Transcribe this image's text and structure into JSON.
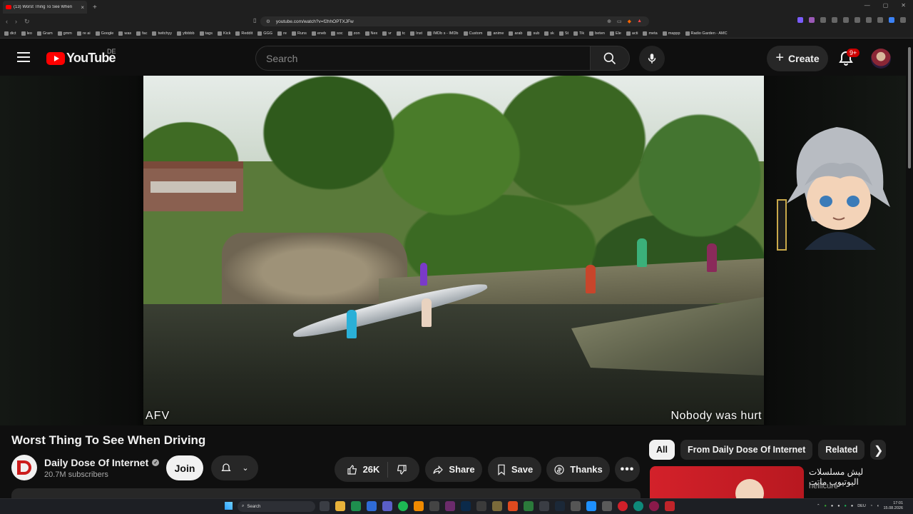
{
  "browser": {
    "tab_title": "(13) Worst Thing To See When",
    "url": "youtube.com/watch?v=f2hhOPTXJFw",
    "bookmarks": [
      "dict",
      "leo",
      "Gram",
      "gmm",
      "re ai",
      "Google",
      "was",
      "fac",
      "twitchyy",
      "ytbbbb",
      "tags",
      "Kick",
      "Reddit",
      "GGG",
      "re",
      "Runs",
      "eneb",
      "soc",
      "zon",
      "Nex",
      "vr",
      "tc",
      "Inst",
      "IMDb s - IMDb",
      "Custom",
      "anime",
      "arab",
      "sub",
      "sk",
      "St",
      "Tik",
      "beten",
      "Ele",
      "acti",
      "meta",
      "mappp",
      "Radio Garden - AMC"
    ]
  },
  "masthead": {
    "logo_text": "YouTube",
    "country_code": "DE",
    "search_placeholder": "Search",
    "create_label": "Create",
    "notification_count": "9+"
  },
  "video": {
    "caption_left": "AFV",
    "caption_right": "Nobody was hurt",
    "title": "Worst Thing To See When Driving"
  },
  "channel": {
    "name": "Daily Dose Of Internet",
    "subscribers": "20.7M subscribers",
    "join_label": "Join"
  },
  "actions": {
    "likes": "26K",
    "share_label": "Share",
    "save_label": "Save",
    "thanks_label": "Thanks"
  },
  "sidebar": {
    "chips": [
      "All",
      "From Daily Dose Of Internet",
      "Related"
    ],
    "rec_title": "ليش مسلسلات اليوتيوب ماتت",
    "rec_channel": "hellicure"
  },
  "taskbar": {
    "search_label": "Search",
    "lang": "DEU",
    "time": "17:01",
    "date": "15.08.2026"
  },
  "colors": {
    "youtube_red": "#ff0000",
    "background": "#0f0f0f",
    "pill": "#272727"
  }
}
